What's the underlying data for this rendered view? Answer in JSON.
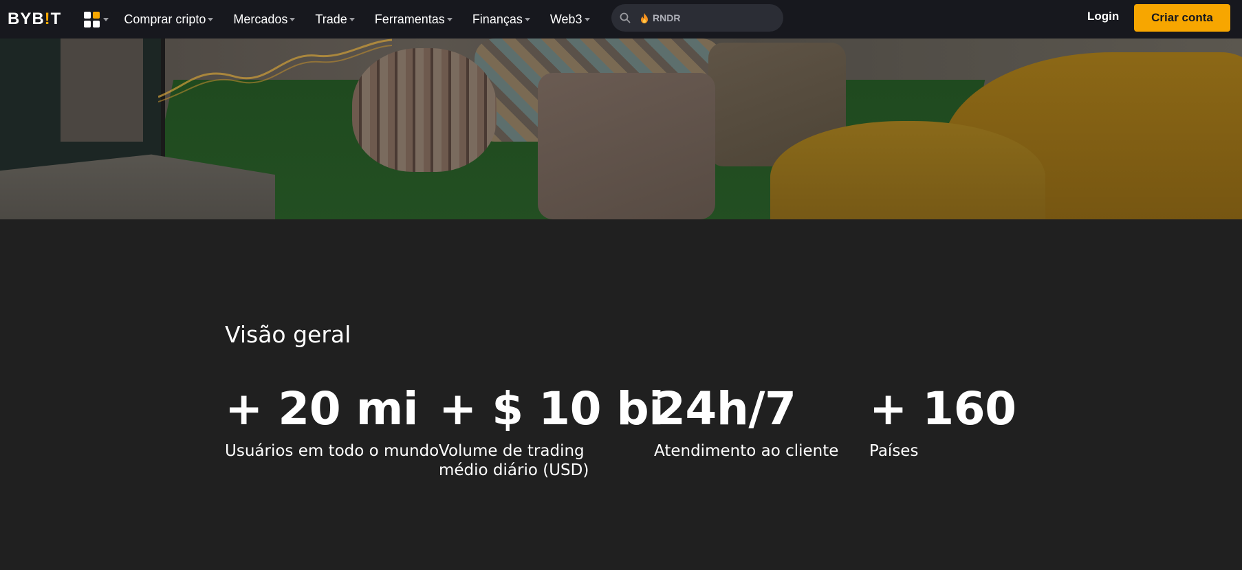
{
  "brand": {
    "logo_text_left": "BYB",
    "logo_text_bang": "!",
    "logo_text_right": "T",
    "accent_color": "#f7a600"
  },
  "nav": {
    "apps_icon": "apps-grid-icon",
    "items": [
      {
        "label": "Comprar cripto"
      },
      {
        "label": "Mercados"
      },
      {
        "label": "Trade"
      },
      {
        "label": "Ferramentas"
      },
      {
        "label": "Finanças"
      },
      {
        "label": "Web3"
      }
    ]
  },
  "search": {
    "icon": "search-icon",
    "hot_icon": "fire-icon",
    "placeholder": "RNDR"
  },
  "auth": {
    "login_label": "Login",
    "signup_label": "Criar conta"
  },
  "overview": {
    "title": "Visão geral",
    "stats": [
      {
        "value": "+ 20 mi",
        "label": "Usuários em todo o mundo"
      },
      {
        "value": "+ $ 10 bi",
        "label": "Volume de trading médio diário (USD)"
      },
      {
        "value": "24h/7",
        "label": "Atendimento ao cliente"
      },
      {
        "value": "+ 160",
        "label": "Países"
      }
    ]
  },
  "colors": {
    "topbar_bg": "#17181e",
    "page_bg": "#202020",
    "search_bg": "#2b2d35"
  }
}
